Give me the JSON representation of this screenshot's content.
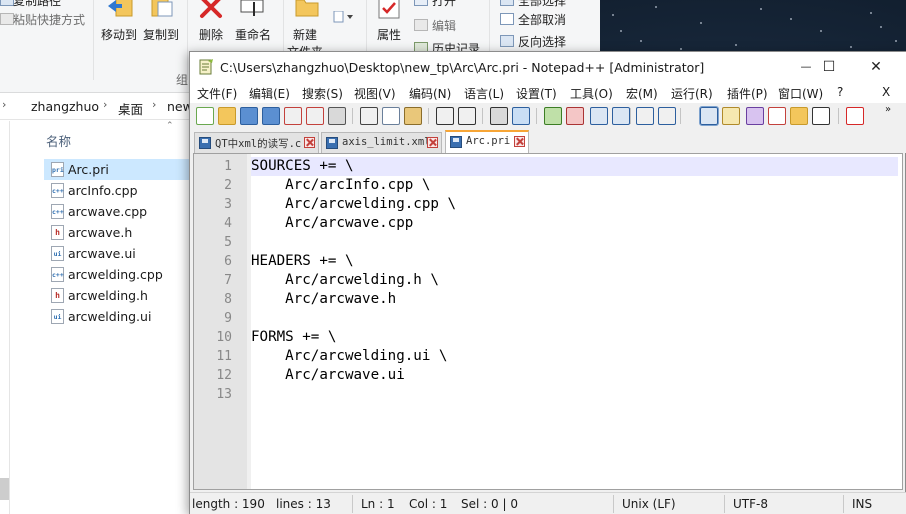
{
  "explorer": {
    "ribbon": {
      "copy_path": "复制路径",
      "paste_shortcut": "粘贴快捷方式",
      "move_to": "移动到",
      "copy_to": "复制到",
      "delete": "删除",
      "rename": "重命名",
      "new_folder": "新建",
      "new_folder_2": "文件夹",
      "properties": "属性",
      "open": "打开",
      "edit": "编辑",
      "history": "历史记录",
      "select_all": "全部选择",
      "select_none": "全部取消",
      "invert_selection": "反向选择",
      "group_org": "组"
    },
    "breadcrumb": {
      "arrow": "›",
      "seg1": "zhangzhuo",
      "seg2": "桌面",
      "seg3": "new"
    },
    "column_name": "名称",
    "files": [
      {
        "name": "Arc.pri",
        "type": "pri"
      },
      {
        "name": "arcInfo.cpp",
        "type": "c++"
      },
      {
        "name": "arcwave.cpp",
        "type": "c++"
      },
      {
        "name": "arcwave.h",
        "type": "h"
      },
      {
        "name": "arcwave.ui",
        "type": "ui"
      },
      {
        "name": "arcwelding.cpp",
        "type": "c++"
      },
      {
        "name": "arcwelding.h",
        "type": "h"
      },
      {
        "name": "arcwelding.ui",
        "type": "ui"
      }
    ]
  },
  "npp": {
    "title": "C:\\Users\\zhangzhuo\\Desktop\\new_tp\\Arc\\Arc.pri - Notepad++ [Administrator]",
    "window_buttons": {
      "minimize": "—",
      "maximize": "☐",
      "close": "✕"
    },
    "menu": [
      "文件(F)",
      "编辑(E)",
      "搜索(S)",
      "视图(V)",
      "编码(N)",
      "语言(L)",
      "设置(T)",
      "工具(O)",
      "宏(M)",
      "运行(R)",
      "插件(P)",
      "窗口(W)",
      "?"
    ],
    "menu_close": "X",
    "toolbar_more": "»",
    "tabs": [
      {
        "label": "QT中xml的读写.c",
        "active": false
      },
      {
        "label": "axis_limit.xml",
        "active": false
      },
      {
        "label": "Arc.pri",
        "active": true
      }
    ],
    "lines": [
      "SOURCES += \\",
      "    Arc/arcInfo.cpp \\",
      "    Arc/arcwelding.cpp \\",
      "    Arc/arcwave.cpp",
      "",
      "HEADERS += \\",
      "    Arc/arcwelding.h \\",
      "    Arc/arcwave.h",
      "",
      "FORMS += \\",
      "    Arc/arcwelding.ui \\",
      "    Arc/arcwave.ui",
      ""
    ],
    "line_numbers": [
      "1",
      "2",
      "3",
      "4",
      "5",
      "6",
      "7",
      "8",
      "9",
      "10",
      "11",
      "12",
      "13"
    ],
    "status": {
      "length": "length : 190",
      "lines": "lines : 13",
      "ln": "Ln : 1",
      "col": "Col : 1",
      "sel": "Sel : 0 | 0",
      "eol": "Unix (LF)",
      "encoding": "UTF-8",
      "mode": "INS"
    }
  }
}
